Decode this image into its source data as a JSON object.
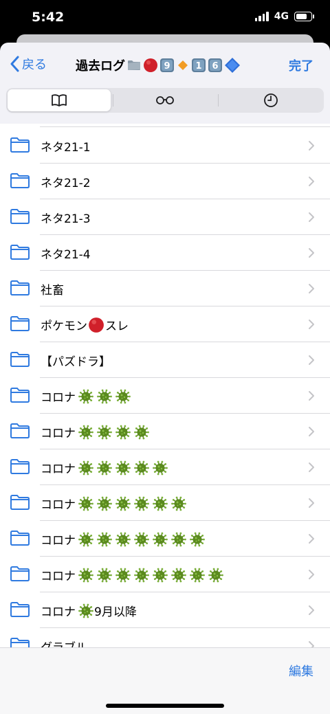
{
  "status": {
    "time": "5:42",
    "network": "4G",
    "battery_level": 0.85
  },
  "navbar": {
    "back_label": "戻る",
    "title": "過去ログ",
    "title_emoji": [
      "folder",
      "red-circle",
      "keycap-9",
      "orange-diamond",
      "keycap-1",
      "keycap-6",
      "blue-diamond"
    ],
    "done_label": "完了"
  },
  "tabs": [
    {
      "icon": "book-icon",
      "selected": true
    },
    {
      "icon": "glasses-icon",
      "selected": false
    },
    {
      "icon": "clock-icon",
      "selected": false
    }
  ],
  "folders": [
    {
      "text": "ネタ21-1",
      "after": "",
      "viruses": 0
    },
    {
      "text": "ネタ21-2",
      "after": "",
      "viruses": 0
    },
    {
      "text": "ネタ21-3",
      "after": "",
      "viruses": 0
    },
    {
      "text": "ネタ21-4",
      "after": "",
      "viruses": 0
    },
    {
      "text": "社畜",
      "after": "",
      "viruses": 0
    },
    {
      "text": "ポケモン",
      "red_ball": true,
      "after": "スレ",
      "viruses": 0
    },
    {
      "text": "【パズドラ】",
      "after": "",
      "viruses": 0
    },
    {
      "text": "コロナ",
      "after": "",
      "viruses": 3
    },
    {
      "text": "コロナ",
      "after": "",
      "viruses": 4
    },
    {
      "text": "コロナ",
      "after": "",
      "viruses": 5
    },
    {
      "text": "コロナ",
      "after": "",
      "viruses": 6
    },
    {
      "text": "コロナ",
      "after": "",
      "viruses": 7
    },
    {
      "text": "コロナ",
      "after": "",
      "viruses": 8
    },
    {
      "text": "コロナ",
      "after": "9月以降",
      "viruses": 1
    },
    {
      "text": "グラブル",
      "after": "",
      "viruses": 0
    }
  ],
  "toolbar": {
    "edit_label": "編集"
  },
  "colors": {
    "accent": "#2f7ae0",
    "virus": "#5a8a1e"
  }
}
